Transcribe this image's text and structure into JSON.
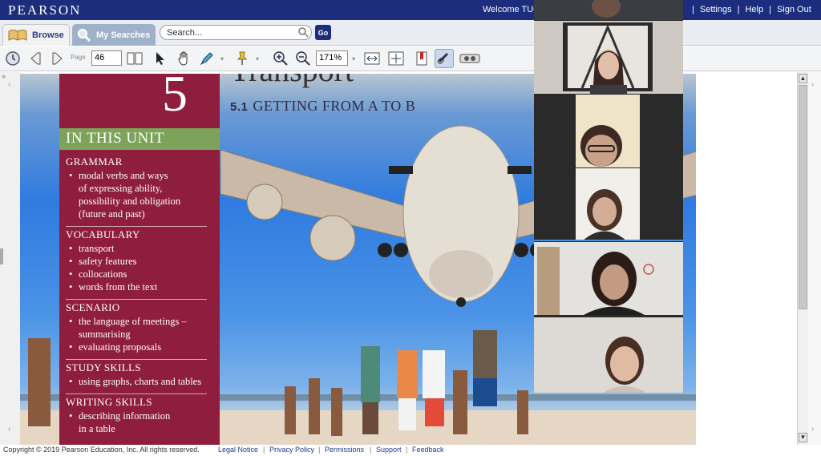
{
  "header": {
    "logo": "PEARSON",
    "welcome": "Welcome TUG",
    "links": [
      "Settings",
      "Help",
      "Sign Out"
    ]
  },
  "tabs": {
    "browse": "Browse",
    "my_searches": "My Searches"
  },
  "search": {
    "placeholder": "Search...",
    "go_label": "Go"
  },
  "toolbar": {
    "page_label": "Page",
    "page_value": "46",
    "zoom_value": "171%"
  },
  "book_page": {
    "unit_number": "5",
    "unit_title": "Transport",
    "section_number": "5.1",
    "section_title": "GETTING FROM A TO B",
    "in_this_unit": "IN THIS UNIT",
    "sections": [
      {
        "heading": "GRAMMAR",
        "items": [
          "modal verbs and ways",
          "of expressing ability,",
          "possibility and obligation",
          "(future and past)"
        ]
      },
      {
        "heading": "VOCABULARY",
        "items": [
          "transport",
          "safety features",
          "collocations",
          "words from the text"
        ]
      },
      {
        "heading": "SCENARIO",
        "items": [
          "the language of meetings –",
          "summarising",
          "evaluating proposals"
        ]
      },
      {
        "heading": "STUDY SKILLS",
        "items": [
          "using graphs, charts and tables"
        ]
      },
      {
        "heading": "WRITING SKILLS",
        "items": [
          "describing information",
          "in a table"
        ]
      }
    ]
  },
  "footer": {
    "copyright": "Copyright © 2019 Pearson Education, Inc. All rights reserved.",
    "links": [
      "Legal Notice",
      "Privacy Policy",
      "Permissions",
      "Support",
      "Feedback"
    ]
  },
  "colors": {
    "header_bg": "#1d2d7e",
    "sidebar_bg": "#8f1d3d",
    "unit_band": "#7da35a"
  }
}
